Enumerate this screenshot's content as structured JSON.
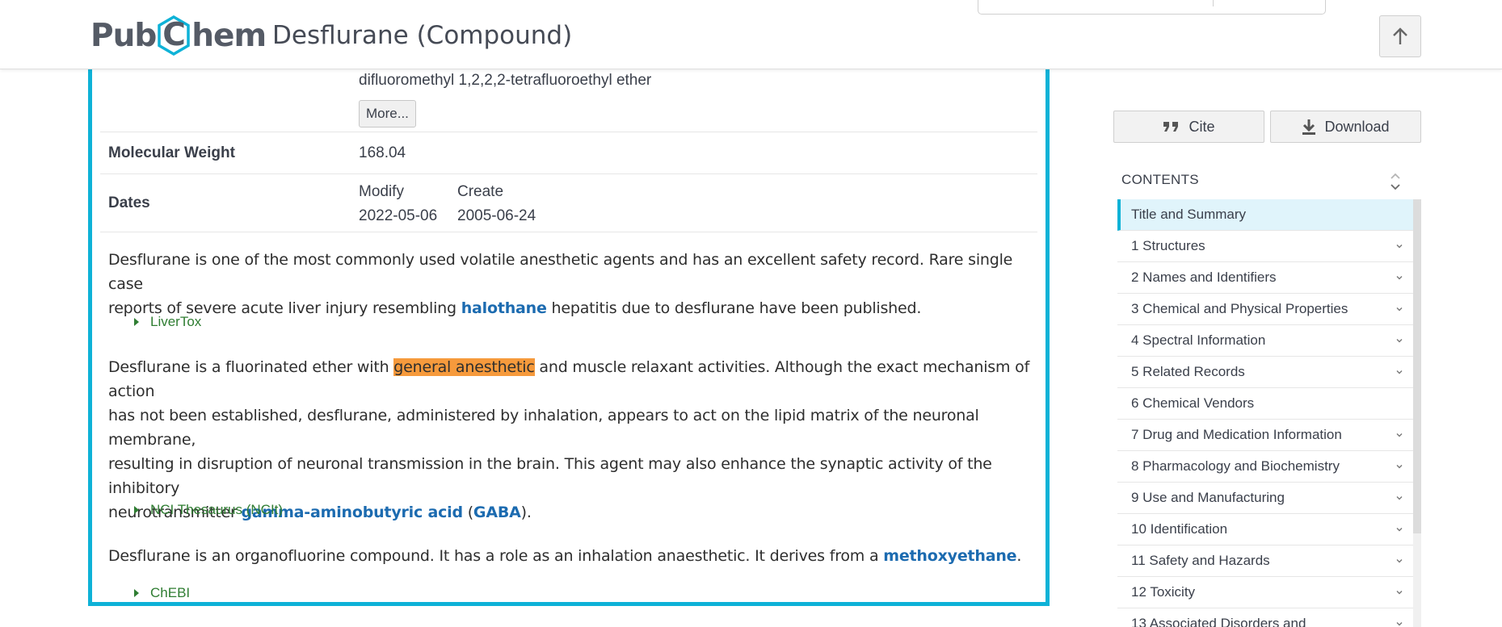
{
  "header": {
    "logo_left": "Pub",
    "logo_mid": "C",
    "logo_right": "hem",
    "title": "Desflurane (Compound)"
  },
  "synonym_tail": "difluoromethyl 1,2,2,2-tetrafluoroethyl ether",
  "more_label": "More...",
  "molecular_weight": {
    "label": "Molecular Weight",
    "value": "168.04"
  },
  "dates": {
    "label": "Dates",
    "modify_label": "Modify",
    "create_label": "Create",
    "modify_value": "2022-05-06",
    "create_value": "2005-06-24"
  },
  "desc1": {
    "line1": "Desflurane is one of the most commonly used volatile anesthetic agents and has an excellent safety record. Rare single case",
    "line2_pre": "reports of severe acute liver injury resembling ",
    "link": "halothane",
    "line2_post": " hepatitis due to desflurane have been published.",
    "source": "LiverTox"
  },
  "desc2": {
    "pre": "Desflurane is a fluorinated ether with ",
    "highlight": "general anesthetic",
    "line1_post": " and muscle relaxant activities. Although the exact mechanism of action",
    "line2": "has not been established, desflurane, administered by inhalation, appears to act on the lipid matrix of the neuronal membrane,",
    "line3": "resulting in disruption of neuronal transmission in the brain. This agent may also enhance the synaptic activity of the inhibitory",
    "line4_pre": "neurotransmitter ",
    "link1": "gamma-aminobutyric acid",
    "paren_open": " (",
    "link2": "GABA",
    "paren_close": ").",
    "source": "NCI Thesaurus (NCIt)"
  },
  "desc3": {
    "pre": "Desflurane is an organofluorine compound. It has a role as an inhalation anaesthetic. It derives from a ",
    "link": "methoxyethane",
    "post": ".",
    "source": "ChEBI"
  },
  "sidebar": {
    "cite_label": "Cite",
    "download_label": "Download",
    "contents_label": "CONTENTS",
    "toc": [
      "Title and Summary",
      "1 Structures",
      "2 Names and Identifiers",
      "3 Chemical and Physical Properties",
      "4 Spectral Information",
      "5 Related Records",
      "6 Chemical Vendors",
      "7 Drug and Medication Information",
      "8 Pharmacology and Biochemistry",
      "9 Use and Manufacturing",
      "10 Identification",
      "11 Safety and Hazards",
      "12 Toxicity",
      "13 Associated Disorders and"
    ]
  },
  "colors": {
    "accent": "#0eb2d7",
    "link": "#1c6bb0",
    "source": "#2f7d32",
    "highlight": "#f69a3c"
  },
  "icons": [
    "hexagon-logo-icon",
    "arrow-up-icon",
    "quote-icon",
    "download-icon",
    "sort-icon",
    "chevron-down-icon",
    "caret-right-icon"
  ]
}
